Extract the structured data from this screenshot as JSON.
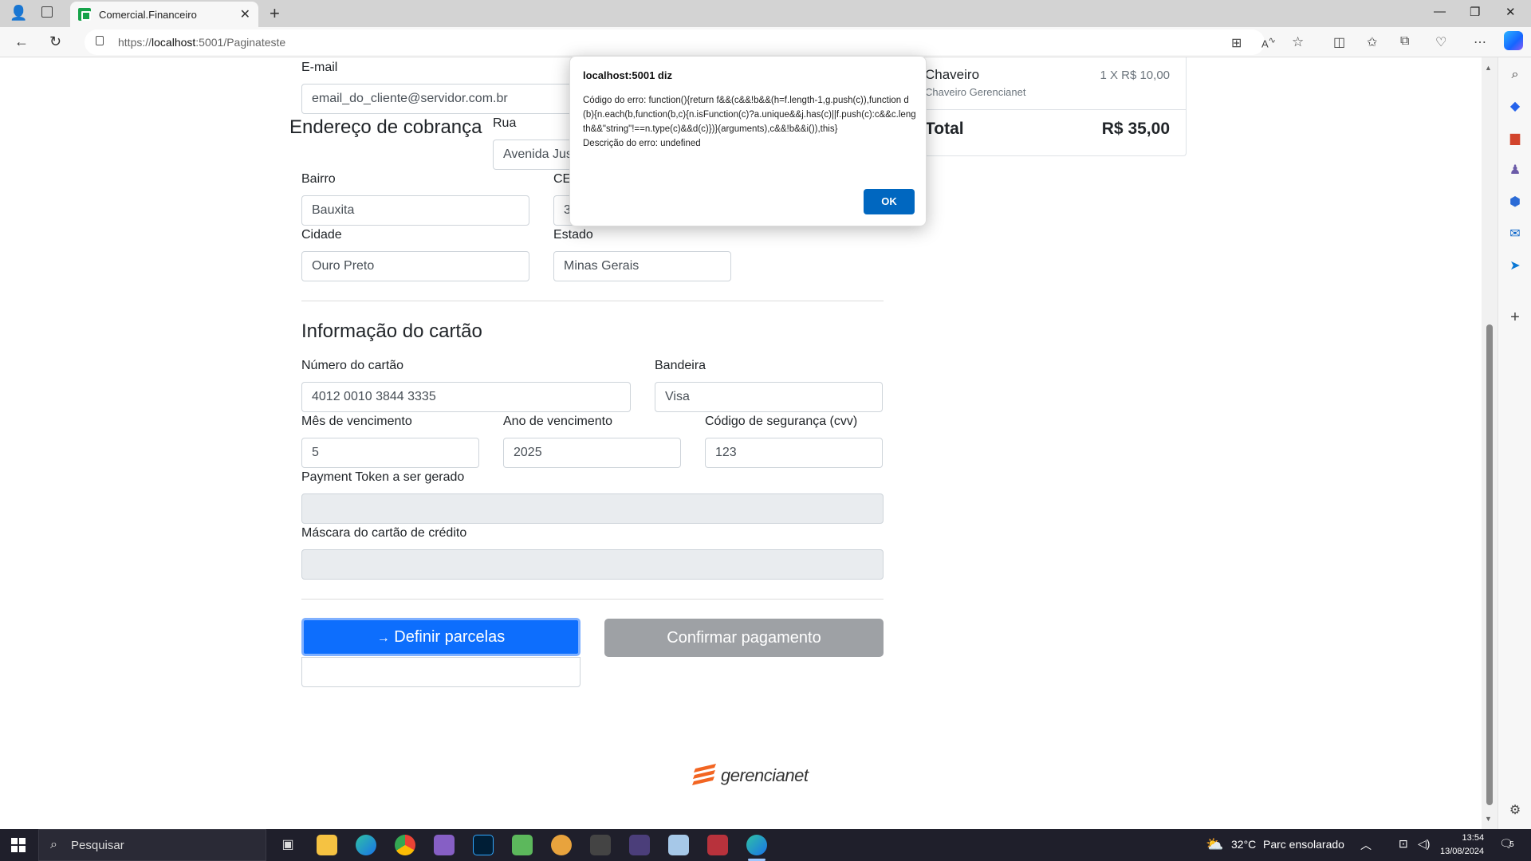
{
  "browser": {
    "tab_title": "Comercial.Financeiro",
    "url_prefix": "https://",
    "url_host": "localhost",
    "url_rest": ":5001/Paginateste"
  },
  "form": {
    "email_label": "E-mail",
    "email_value": "email_do_cliente@servidor.com.br",
    "billing_heading": "Endereço de cobrança",
    "street_label": "Rua",
    "street_value": "Avenida Jus",
    "neighborhood_label": "Bairro",
    "neighborhood_value": "Bauxita",
    "zip_label": "CE",
    "zip_value": "3",
    "city_label": "Cidade",
    "city_value": "Ouro Preto",
    "state_label": "Estado",
    "state_value": "Minas Gerais",
    "card_heading": "Informação do cartão",
    "card_number_label": "Número do cartão",
    "card_number_value": "4012 0010 3844 3335",
    "brand_label": "Bandeira",
    "brand_value": "Visa",
    "exp_month_label": "Mês de vencimento",
    "exp_month_value": "5",
    "exp_year_label": "Ano de vencimento",
    "exp_year_value": "2025",
    "cvv_label": "Código de segurança (cvv)",
    "cvv_value": "123",
    "token_label": "Payment Token a ser gerado",
    "token_value": "",
    "mask_label": "Máscara do cartão de crédito",
    "mask_value": "",
    "define_installments_button": "Definir parcelas",
    "confirm_payment_button": "Confirmar pagamento"
  },
  "cart": {
    "item_name": "Chaveiro",
    "item_sub": "Chaveiro Gerencianet",
    "item_qty": "1 X R$ 10,00",
    "total_label": "Total",
    "total_value": "R$ 35,00"
  },
  "logo_text": "gerencianet",
  "dialog": {
    "title": "localhost:5001 diz",
    "message": "Código do erro: function(){return f&&(c&&!b&&(h=f.length-1,g.push(c)),function d(b){n.each(b,function(b,c){n.isFunction(c)?a.unique&&j.has(c)||f.push(c):c&&c.length&&\"string\"!==n.type(c)&&d(c)})}(arguments),c&&!b&&i()),this}\nDescrição do erro: undefined",
    "ok_label": "OK"
  },
  "taskbar": {
    "search_placeholder": "Pesquisar",
    "weather": "32°C",
    "weather_desc": "Parc ensolarado",
    "time": "13:54",
    "date": "13/08/2024",
    "notification_count": "5"
  },
  "colors": {
    "primary": "#0d6efd",
    "secondary": "#9ea1a5",
    "dialog_ok": "#0067c0"
  }
}
